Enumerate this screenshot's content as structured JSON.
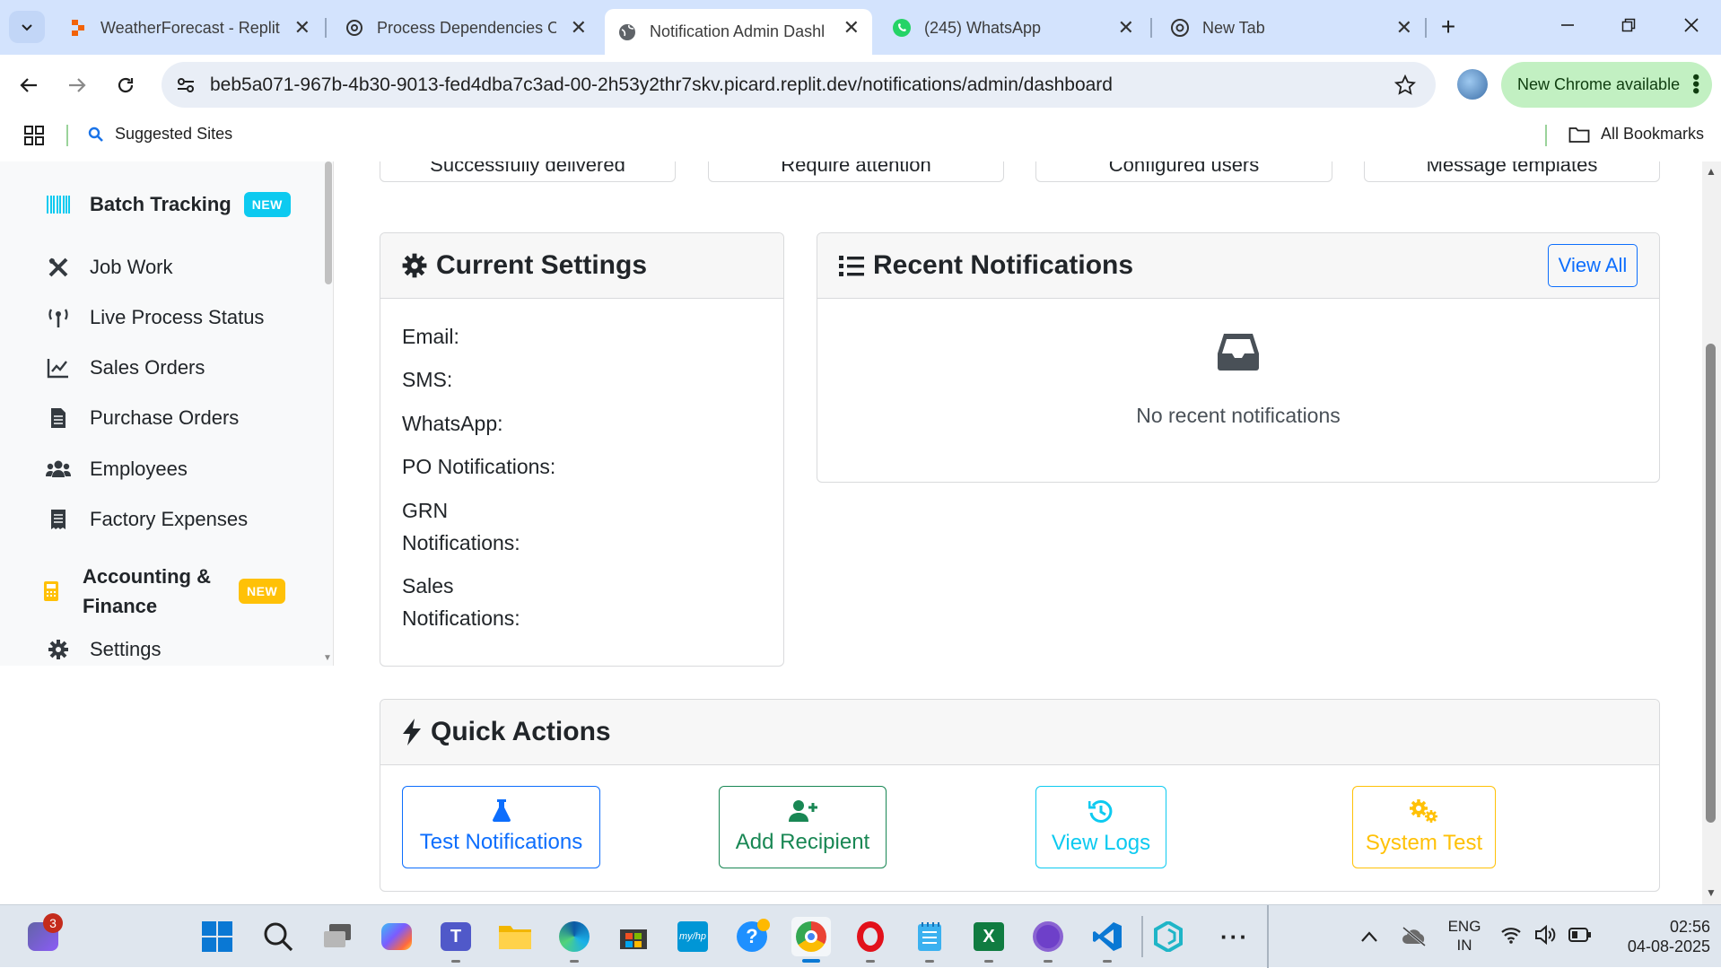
{
  "browser": {
    "tabs": [
      {
        "title": "WeatherForecast - Replit",
        "icon": "replit-icon"
      },
      {
        "title": "Process Dependencies O",
        "icon": "openai-icon"
      },
      {
        "title": "Notification Admin Dashl",
        "icon": "globe-icon"
      },
      {
        "title": "(245) WhatsApp",
        "icon": "whatsapp-icon"
      },
      {
        "title": "New Tab",
        "icon": "chrome-icon"
      }
    ],
    "url": "beb5a071-967b-4b30-9013-fed4dba7c3ad-00-2h53y2thr7skv.picard.replit.dev/notifications/admin/dashboard",
    "update_label": "New Chrome available",
    "bookmarks": {
      "suggested": "Suggested Sites",
      "all": "All Bookmarks"
    }
  },
  "sidebar": {
    "items": [
      {
        "label": "Batch Tracking",
        "icon": "barcode-icon",
        "badge": "NEW",
        "badge_color": "#0dcaf0"
      },
      {
        "label": "Job Work",
        "icon": "tools-icon"
      },
      {
        "label": "Live Process Status",
        "icon": "broadcast-icon"
      },
      {
        "label": "Sales Orders",
        "icon": "chart-line-icon"
      },
      {
        "label": "Purchase Orders",
        "icon": "file-invoice-icon"
      },
      {
        "label": "Employees",
        "icon": "users-icon"
      },
      {
        "label": "Factory Expenses",
        "icon": "receipt-icon"
      },
      {
        "label": "Accounting & Finance",
        "icon": "calculator-icon",
        "badge": "NEW",
        "badge_color": "#ffc107"
      },
      {
        "label": "Settings",
        "icon": "gear-icon"
      }
    ]
  },
  "stats_captions": [
    "Successfully delivered",
    "Require attention",
    "Configured users",
    "Message templates"
  ],
  "settings": {
    "title": "Current Settings",
    "rows": [
      "Email:",
      "SMS:",
      "WhatsApp:",
      "PO Notifications:",
      "GRN Notifications:",
      "Sales Notifications:"
    ]
  },
  "recent": {
    "title": "Recent Notifications",
    "view_all": "View All",
    "empty_text": "No recent notifications"
  },
  "quick_actions": {
    "title": "Quick Actions",
    "buttons": [
      {
        "label": "Test Notifications",
        "icon": "flask-icon",
        "color": "#0d6efd"
      },
      {
        "label": "Add Recipient",
        "icon": "user-plus-icon",
        "color": "#198754"
      },
      {
        "label": "View Logs",
        "icon": "history-icon",
        "color": "#0dcaf0"
      },
      {
        "label": "System Test",
        "icon": "cogs-icon",
        "color": "#ffc107"
      }
    ]
  },
  "taskbar": {
    "teams_badge": "3",
    "lang": "ENG",
    "region": "IN",
    "time": "02:56",
    "date": "04-08-2025"
  },
  "colors": {
    "accent": "#0d6efd",
    "chrome_bg": "#d3e3fd",
    "update_pill": "#c2f0c2"
  }
}
